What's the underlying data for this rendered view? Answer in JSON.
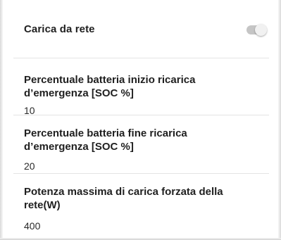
{
  "settings": {
    "grid_charge": {
      "label": "Carica da rete",
      "enabled": false
    },
    "items": [
      {
        "title": "Percentuale batteria inizio ricarica d’emergenza [SOC %]",
        "value": "10"
      },
      {
        "title": "Percentuale batteria fine ricarica d’emergenza [SOC %]",
        "value": "20"
      },
      {
        "title": "Potenza massima di carica forzata della rete(W)",
        "value": "400"
      }
    ]
  },
  "colors": {
    "text": "#1f1f1f",
    "divider": "#e4e4e4",
    "switch_track_off": "#c5c5c5",
    "switch_thumb": "#f1f1f1"
  }
}
